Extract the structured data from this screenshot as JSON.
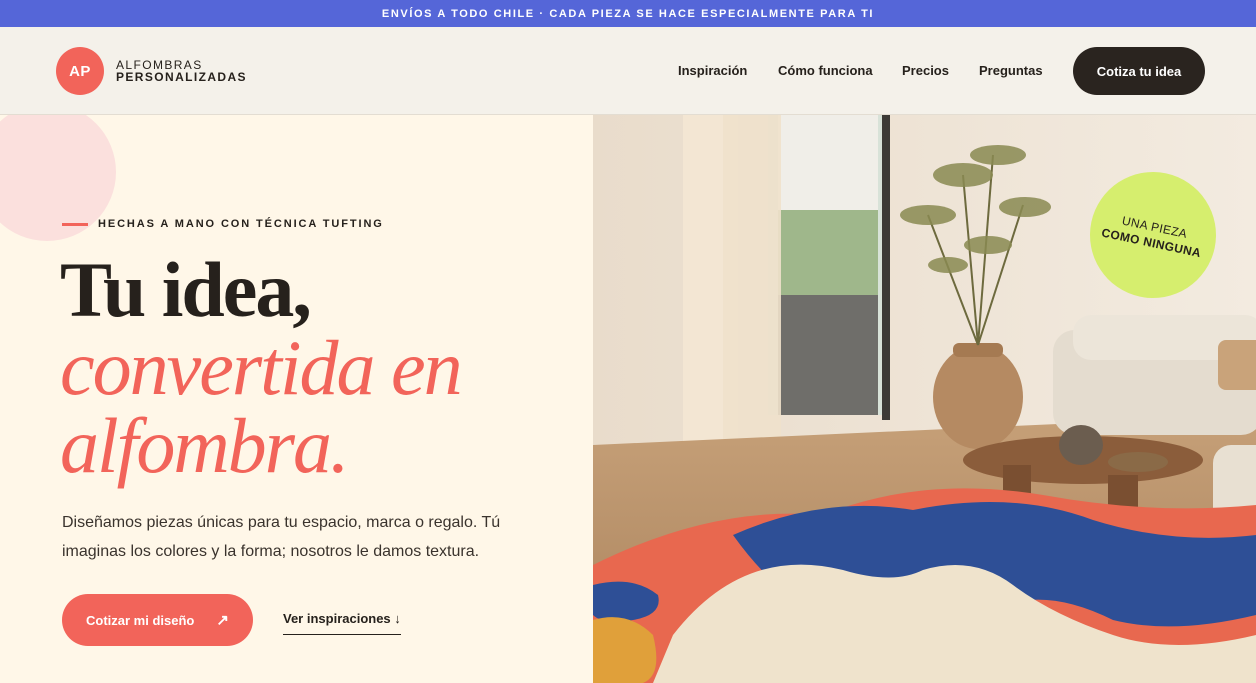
{
  "announcement": "ENVÍOS A TODO CHILE · CADA PIEZA SE HACE ESPECIALMENTE PARA TI",
  "brand": {
    "initials": "AP",
    "line1": "ALFOMBRAS",
    "line2": "PERSONALIZADAS"
  },
  "nav": {
    "items": [
      {
        "label": "Inspiración"
      },
      {
        "label": "Cómo funciona"
      },
      {
        "label": "Precios"
      },
      {
        "label": "Preguntas"
      }
    ],
    "cta": "Cotiza tu idea"
  },
  "hero": {
    "eyebrow": "HECHAS A MANO CON TÉCNICA TUFTING",
    "headline_line1": "Tu idea,",
    "headline_line2": "convertida en",
    "headline_line3": "alfombra.",
    "subtitle": "Diseñamos piezas únicas para tu espacio, marca o regalo. Tú imaginas los colores y la forma; nosotros le damos textura.",
    "primary_button": "Cotizar mi diseño",
    "primary_button_icon": "↗",
    "secondary_link": "Ver inspiraciones ↓",
    "badge_line1": "UNA PIEZA",
    "badge_line2": "COMO NINGUNA"
  },
  "colors": {
    "announcement_bg": "#5566d8",
    "accent": "#f2645a",
    "dark": "#2a241f",
    "badge": "#d6ee6e",
    "rug_blue": "#2e4f96",
    "rug_coral": "#e8684f",
    "rug_cream": "#efe3cc"
  }
}
